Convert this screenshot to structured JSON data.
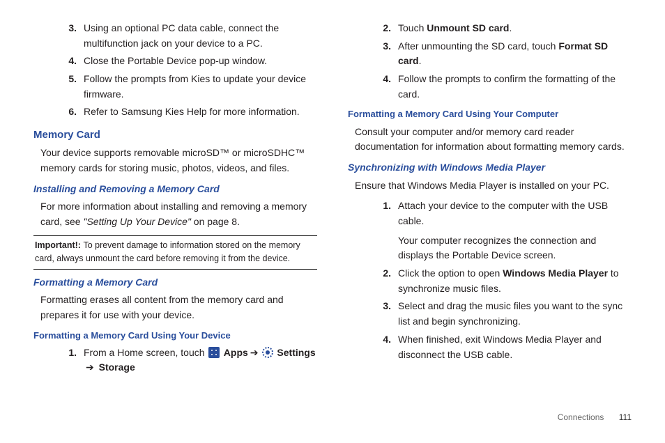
{
  "left": {
    "steps1": [
      {
        "n": "3.",
        "t": "Using an optional PC data cable, connect the multifunction jack on your device to a PC."
      },
      {
        "n": "4.",
        "t": "Close the Portable Device pop-up window."
      },
      {
        "n": "5.",
        "t": "Follow the prompts from Kies to update your device firmware."
      },
      {
        "n": "6.",
        "t": "Refer to Samsung Kies Help for more information."
      }
    ],
    "h_memory": "Memory Card",
    "p_memory": "Your device supports removable microSD™ or microSDHC™ memory cards for storing music, photos, videos, and files.",
    "h_install": "Installing and Removing a Memory Card",
    "p_install_pre": "For more information about installing and removing a memory card, see ",
    "p_install_quote": "\"Setting Up Your Device\"",
    "p_install_post": " on page 8.",
    "imp_label": "Important!: ",
    "imp_text": "To prevent damage to information stored on the memory card, always unmount the card before removing it from the device.",
    "h_format": "Formatting a Memory Card",
    "p_format": "Formatting erases all content from the memory card and prepares it for use with your device.",
    "h_format_dev": "Formatting a Memory Card Using Your Device",
    "step_home_n": "1.",
    "step_home_pre": "From a Home screen, touch ",
    "apps": " Apps",
    "settings": " Settings ",
    "storage": " Storage",
    "arrow": "➔"
  },
  "right": {
    "step2_n": "2.",
    "step2_pre": "Touch ",
    "step2_b": "Unmount SD card",
    "step2_post": ".",
    "step3_n": "3.",
    "step3_pre": "After unmounting the SD card, touch ",
    "step3_b": "Format SD card",
    "step3_post": ".",
    "step4_n": "4.",
    "step4_t": "Follow the prompts to confirm the formatting of the card.",
    "h_comp": "Formatting a Memory Card Using Your Computer",
    "p_comp": "Consult your computer and/or memory card reader documentation for information about formatting memory cards.",
    "h_sync": "Synchronizing with Windows Media Player",
    "p_sync": "Ensure that Windows Media Player is installed on your PC.",
    "s1_n": "1.",
    "s1_t1": "Attach your device to the computer with the USB cable.",
    "s1_t2": "Your computer recognizes the connection and displays the Portable Device screen.",
    "s2_n": "2.",
    "s2_pre": "Click the option to open ",
    "s2_b": "Windows Media Player",
    "s2_post": " to synchronize music files.",
    "s3_n": "3.",
    "s3_t": "Select and drag the music files you want to the sync list and begin synchronizing.",
    "s4_n": "4.",
    "s4_t": "When finished, exit Windows Media Player and disconnect the USB cable."
  },
  "footer": {
    "section": "Connections",
    "page": "111"
  }
}
